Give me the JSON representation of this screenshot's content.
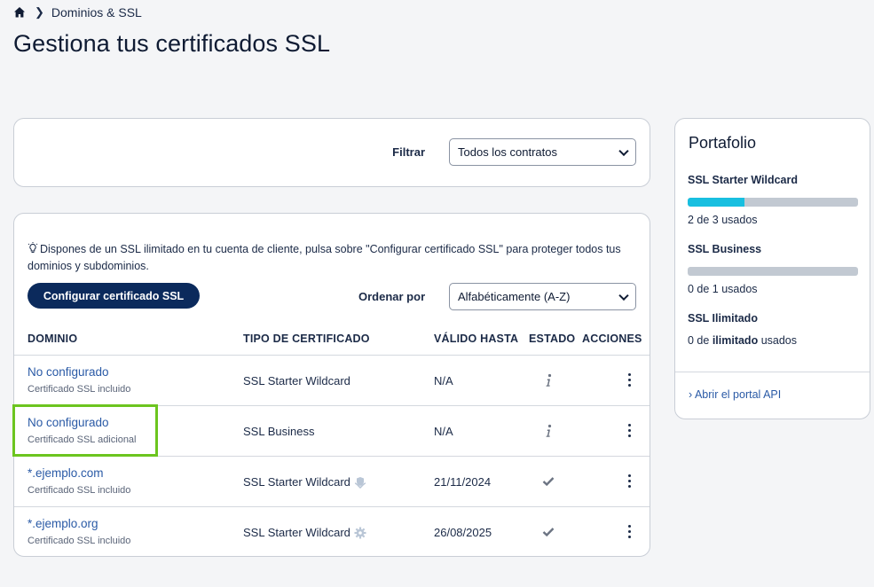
{
  "breadcrumb": {
    "current": "Dominios & SSL"
  },
  "page": {
    "title": "Gestiona tus certificados SSL"
  },
  "filter": {
    "label": "Filtrar",
    "selected": "Todos los contratos"
  },
  "list": {
    "info": "Dispones de un SSL ilimitado en tu cuenta de cliente, pulsa sobre \"Configurar certificado SSL\" para proteger todos tus dominios y subdominios.",
    "configure_button": "Configurar certificado SSL",
    "sort_label": "Ordenar por",
    "sort_selected": "Alfabéticamente (A-Z)",
    "columns": {
      "domain": "DOMINIO",
      "cert_type": "TIPO DE CERTIFICADO",
      "valid_until": "VÁLIDO HASTA",
      "status": "ESTADO",
      "actions": "ACCIONES"
    },
    "rows": [
      {
        "domain": "No configurado",
        "sub": "Certificado SSL incluido",
        "cert": "SSL Starter Wildcard",
        "valid": "N/A",
        "status": "info-icon",
        "cert_icon": ""
      },
      {
        "domain": "No configurado",
        "sub": "Certificado SSL adicional",
        "cert": "SSL Business",
        "valid": "N/A",
        "status": "info-icon",
        "cert_icon": ""
      },
      {
        "domain": "*.ejemplo.com",
        "sub": "Certificado SSL incluido",
        "cert": "SSL Starter Wildcard",
        "valid": "21/11/2024",
        "status": "check-icon",
        "cert_icon": "shield-hand-icon"
      },
      {
        "domain": "*.ejemplo.org",
        "sub": "Certificado SSL incluido",
        "cert": "SSL Starter Wildcard",
        "valid": "26/08/2025",
        "status": "check-icon",
        "cert_icon": "gear-icon"
      }
    ]
  },
  "portfolio": {
    "title": "Portafolio",
    "items": [
      {
        "name": "SSL Starter Wildcard",
        "usage": "2 de 3 usados",
        "fraction": 0.333
      },
      {
        "name": "SSL Business",
        "usage": "0 de 1 usados",
        "fraction": 0
      },
      {
        "name": "SSL Ilimitado",
        "usage_prefix": "0 de ",
        "usage_bold": "ilimitado",
        "usage_suffix": " usados"
      }
    ],
    "api_link": "Abrir el portal API"
  },
  "colors": {
    "accent": "#0b2a5c",
    "link": "#2a5aa6",
    "progress": "#18bfe0",
    "highlight": "#6cc51f"
  }
}
